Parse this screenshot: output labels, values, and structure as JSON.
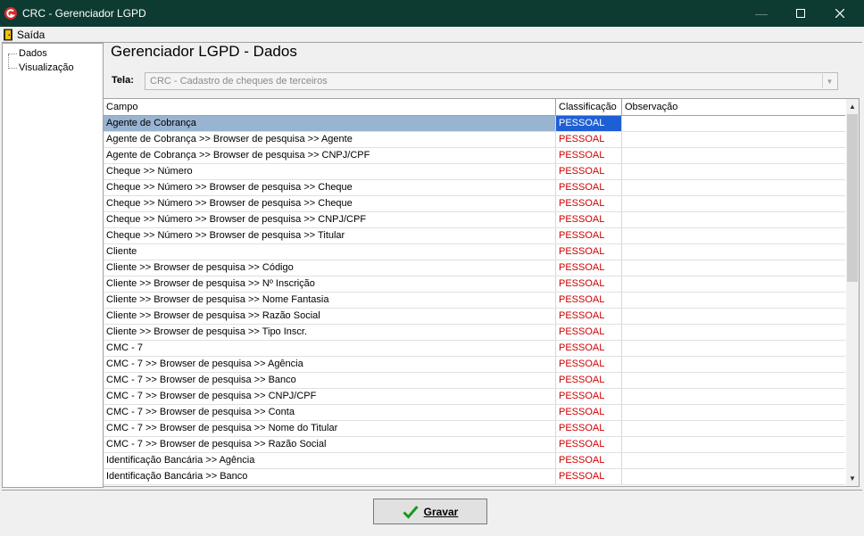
{
  "window": {
    "title": "CRC - Gerenciador LGPD"
  },
  "menu": {
    "exit_label": "Saída"
  },
  "tree": {
    "items": [
      "Dados",
      "Visualização"
    ]
  },
  "panel": {
    "title": "Gerenciador LGPD - Dados",
    "tela_label": "Tela:",
    "tela_value": "CRC - Cadastro de cheques de terceiros"
  },
  "grid": {
    "columns": [
      "Campo",
      "Classificação",
      "Observação"
    ],
    "rows": [
      {
        "campo": "Agente de Cobrança",
        "classificacao": "PESSOAL",
        "observacao": ""
      },
      {
        "campo": "Agente de Cobrança >> Browser de pesquisa >> Agente",
        "classificacao": "PESSOAL",
        "observacao": ""
      },
      {
        "campo": "Agente de Cobrança >> Browser de pesquisa >> CNPJ/CPF",
        "classificacao": "PESSOAL",
        "observacao": ""
      },
      {
        "campo": "Cheque >> Número",
        "classificacao": "PESSOAL",
        "observacao": ""
      },
      {
        "campo": "Cheque >> Número >> Browser de pesquisa >> Cheque",
        "classificacao": "PESSOAL",
        "observacao": ""
      },
      {
        "campo": "Cheque >> Número >> Browser de pesquisa >> Cheque",
        "classificacao": "PESSOAL",
        "observacao": ""
      },
      {
        "campo": "Cheque >> Número >> Browser de pesquisa >> CNPJ/CPF",
        "classificacao": "PESSOAL",
        "observacao": ""
      },
      {
        "campo": "Cheque >> Número >> Browser de pesquisa >> Titular",
        "classificacao": "PESSOAL",
        "observacao": ""
      },
      {
        "campo": "Cliente",
        "classificacao": "PESSOAL",
        "observacao": ""
      },
      {
        "campo": "Cliente >> Browser de pesquisa >> Código",
        "classificacao": "PESSOAL",
        "observacao": ""
      },
      {
        "campo": "Cliente >> Browser de pesquisa >> Nº Inscrição",
        "classificacao": "PESSOAL",
        "observacao": ""
      },
      {
        "campo": "Cliente >> Browser de pesquisa >> Nome Fantasia",
        "classificacao": "PESSOAL",
        "observacao": ""
      },
      {
        "campo": "Cliente >> Browser de pesquisa >> Razão Social",
        "classificacao": "PESSOAL",
        "observacao": ""
      },
      {
        "campo": "Cliente >> Browser de pesquisa >> Tipo Inscr.",
        "classificacao": "PESSOAL",
        "observacao": ""
      },
      {
        "campo": "CMC - 7",
        "classificacao": "PESSOAL",
        "observacao": ""
      },
      {
        "campo": "CMC - 7 >> Browser de pesquisa >> Agência",
        "classificacao": "PESSOAL",
        "observacao": ""
      },
      {
        "campo": "CMC - 7 >> Browser de pesquisa >> Banco",
        "classificacao": "PESSOAL",
        "observacao": ""
      },
      {
        "campo": "CMC - 7 >> Browser de pesquisa >> CNPJ/CPF",
        "classificacao": "PESSOAL",
        "observacao": ""
      },
      {
        "campo": "CMC - 7 >> Browser de pesquisa >> Conta",
        "classificacao": "PESSOAL",
        "observacao": ""
      },
      {
        "campo": "CMC - 7 >> Browser de pesquisa >> Nome do Titular",
        "classificacao": "PESSOAL",
        "observacao": ""
      },
      {
        "campo": "CMC - 7 >> Browser de pesquisa >> Razão Social",
        "classificacao": "PESSOAL",
        "observacao": ""
      },
      {
        "campo": "Identificação Bancária >> Agência",
        "classificacao": "PESSOAL",
        "observacao": ""
      },
      {
        "campo": "Identificação Bancária >> Banco",
        "classificacao": "PESSOAL",
        "observacao": ""
      }
    ],
    "selected_row": 0
  },
  "footer": {
    "save_label": "Gravar"
  },
  "colors": {
    "titlebar": "#0d3b32",
    "selection": "#1f5fd6",
    "classification_text": "#d00000"
  }
}
